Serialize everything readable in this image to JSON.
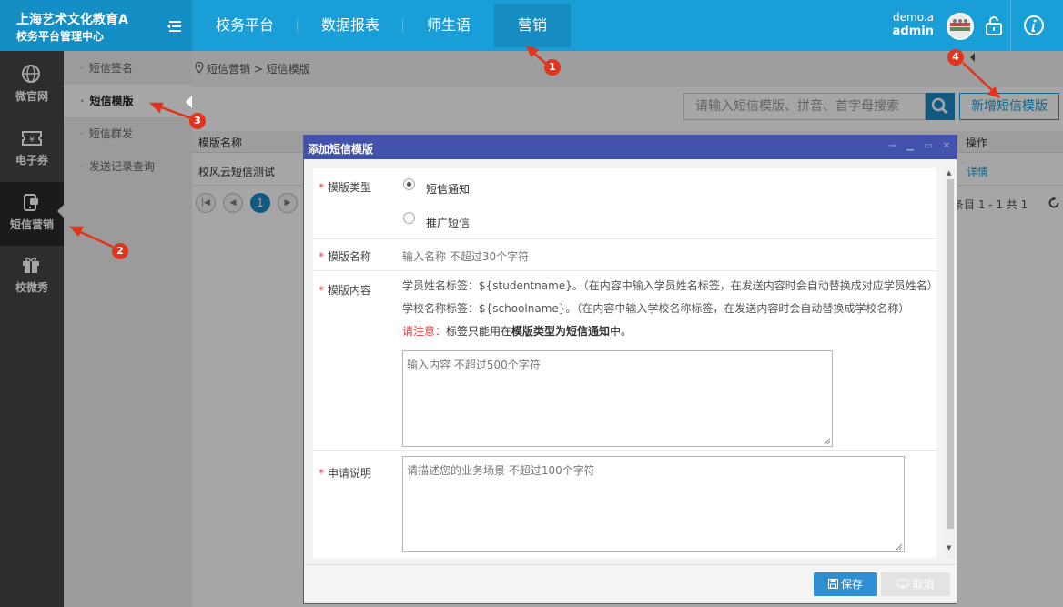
{
  "brand": {
    "line1": "上海艺术文化教育A",
    "line2": "校务平台管理中心"
  },
  "nav": {
    "items": [
      "校务平台",
      "数据报表",
      "师生语",
      "营销"
    ],
    "active": "营销"
  },
  "user": {
    "account": "demo.a",
    "name": "admin"
  },
  "sidebar": {
    "items": [
      {
        "label": "微官网",
        "icon": "globe-icon"
      },
      {
        "label": "电子券",
        "icon": "ticket-icon"
      },
      {
        "label": "短信营销",
        "icon": "sms-icon"
      },
      {
        "label": "校微秀",
        "icon": "gift-icon"
      }
    ],
    "active": "短信营销"
  },
  "submenu": {
    "items": [
      "短信签名",
      "短信模版",
      "短信群发",
      "发送记录查询"
    ],
    "active": "短信模版",
    "bullet": "·"
  },
  "breadcrumb": "短信营销 > 短信模版",
  "search": {
    "placeholder": "请输入短信模版、拼音、首字母搜索"
  },
  "add_button": "新增短信模版",
  "table": {
    "columns": [
      "模版名称",
      "操作"
    ],
    "rows": [
      {
        "name": "校风云短信测试",
        "action": "详情"
      }
    ]
  },
  "pager": {
    "current": "1",
    "info": "条目 1 - 1 共 1"
  },
  "modal": {
    "title": "添加短信模版",
    "required_mark": "*",
    "type_label": "模版类型",
    "type_options": [
      "短信通知",
      "推广短信"
    ],
    "type_selected": "短信通知",
    "name_label": "模版名称",
    "name_placeholder": "输入名称 不超过30个字符",
    "content_label": "模版内容",
    "hint1": "学员姓名标签：${studentname}。（在内容中输入学员姓名标签，在发送内容时会自动替换成对应学员姓名）",
    "hint2": "学校名称标签：${schoolname}。（在内容中输入学校名称标签，在发送内容时会自动替换成学校名称）",
    "notice_prefix": "请注意：",
    "notice_text1": "标签只能用在",
    "notice_bold": "模版类型为短信通知",
    "notice_text2": "中。",
    "content_placeholder": "输入内容 不超过500个字符",
    "desc_label": "申请说明",
    "desc_placeholder": "请描述您的业务场景 不超过100个字符",
    "save": "保存",
    "cancel": "取消"
  },
  "annotations": [
    "1",
    "2",
    "3",
    "4"
  ],
  "colors": {
    "primary": "#1a9ed8",
    "modal_header": "#4353ad",
    "annotation": "#e1341e",
    "required": "#e53c3c"
  }
}
